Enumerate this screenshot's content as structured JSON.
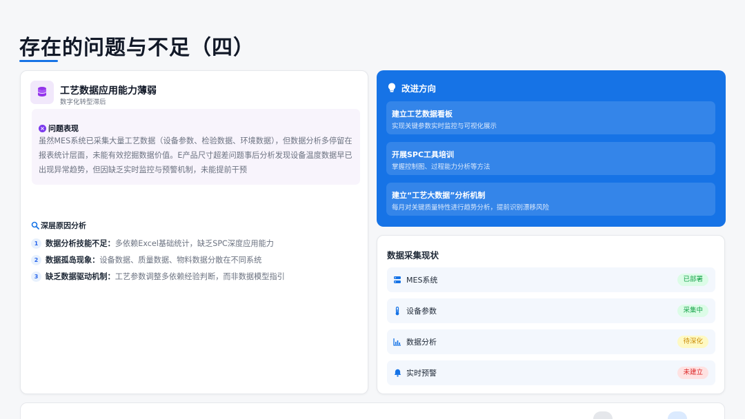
{
  "page": {
    "title": "存在的问题与不足（四）"
  },
  "left_card": {
    "title": "工艺数据应用能力薄弱",
    "subtitle": "数字化转型滞后",
    "issue": {
      "heading": "问题表现",
      "text": "虽然MES系统已采集大量工艺数据（设备参数、检验数据、环境数据），但数据分析多停留在报表统计层面，未能有效挖掘数据价值。E产品尺寸超差问题事后分析发现设备温度数据早已出现异常趋势，但因缺乏实时监控与预警机制，未能提前干预"
    },
    "causes": {
      "heading": "深层原因分析",
      "items": [
        {
          "num": "1",
          "label": "数据分析技能不足：",
          "text": "多依赖Excel基础统计，缺乏SPC深度应用能力"
        },
        {
          "num": "2",
          "label": "数据孤岛现象：",
          "text": "设备数据、质量数据、物料数据分散在不同系统"
        },
        {
          "num": "3",
          "label": "缺乏数据驱动机制：",
          "text": "工艺参数调整多依赖经验判断，而非数据模型指引"
        }
      ]
    }
  },
  "improvement": {
    "heading": "改进方向",
    "items": [
      {
        "title": "建立工艺数据看板",
        "desc": "实现关键参数实时监控与可视化展示"
      },
      {
        "title": "开展SPC工具培训",
        "desc": "掌握控制图、过程能力分析等方法"
      },
      {
        "title": "建立“工艺大数据”分析机制",
        "desc": "每月对关键质量特性进行趋势分析，提前识别漂移风险"
      }
    ]
  },
  "data_collection": {
    "heading": "数据采集现状",
    "rows": [
      {
        "icon": "server-icon",
        "label": "MES系统",
        "status": "已部署",
        "status_color": "#16a34a",
        "status_bg": "#dcfce7"
      },
      {
        "icon": "thermometer-icon",
        "label": "设备参数",
        "status": "采集中",
        "status_color": "#16a34a",
        "status_bg": "#dcfce7"
      },
      {
        "icon": "chart-icon",
        "label": "数据分析",
        "status": "待深化",
        "status_color": "#ca8a04",
        "status_bg": "#fef9c3"
      },
      {
        "icon": "bell-icon",
        "label": "实时预警",
        "status": "未建立",
        "status_color": "#dc2626",
        "status_bg": "#fee2e2"
      }
    ]
  },
  "colors": {
    "accent": "#1673e6",
    "purple": "#7c3aed"
  }
}
